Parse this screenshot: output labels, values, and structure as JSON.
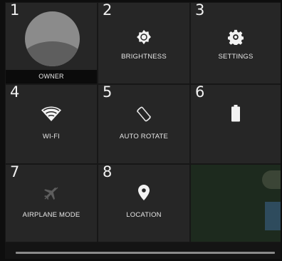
{
  "tiles": [
    {
      "number": "1",
      "label": "OWNER",
      "icon": "avatar-icon"
    },
    {
      "number": "2",
      "label": "BRIGHTNESS",
      "icon": "brightness-icon"
    },
    {
      "number": "3",
      "label": "SETTINGS",
      "icon": "gear-icon"
    },
    {
      "number": "4",
      "label": "WI-FI",
      "icon": "wifi-icon"
    },
    {
      "number": "5",
      "label": "AUTO ROTATE",
      "icon": "auto-rotate-icon"
    },
    {
      "number": "6",
      "label": "",
      "icon": "battery-icon"
    },
    {
      "number": "7",
      "label": "AIRPLANE MODE",
      "icon": "airplane-icon"
    },
    {
      "number": "8",
      "label": "LOCATION",
      "icon": "location-pin-icon"
    }
  ],
  "colors": {
    "tile": "#262626",
    "panel": "#171717",
    "text": "#e6e6e6"
  }
}
